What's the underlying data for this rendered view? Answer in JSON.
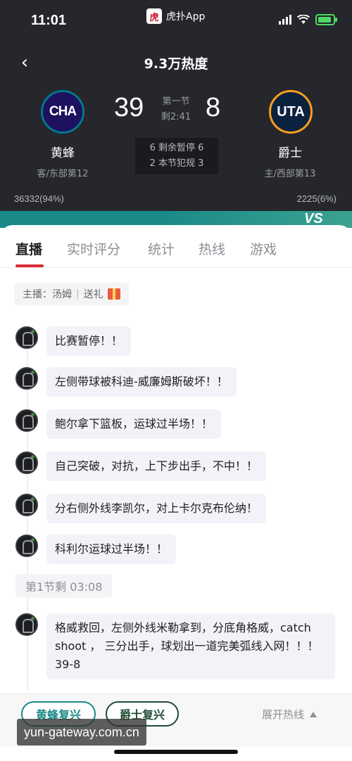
{
  "status_bar": {
    "time": "11:01",
    "app_logo": "虎",
    "app_name": "虎扑App"
  },
  "header": {
    "title": "9.3万热度",
    "home": {
      "abbr": "CHA",
      "name": "黄蜂",
      "rank": "客/东部第12",
      "score": "39",
      "support": "36332(94%)"
    },
    "away": {
      "abbr": "UTA",
      "name": "爵士",
      "rank": "主/西部第13",
      "score": "8",
      "support": "2225(6%)"
    },
    "period": "第一节",
    "clock": "剩2:41",
    "timeouts": "6 剩余暂停 6",
    "fouls": "2 本节犯规 3",
    "vs": "VS"
  },
  "tabs": [
    {
      "label": "直播"
    },
    {
      "label": "实时评分"
    },
    {
      "label": "统计"
    },
    {
      "label": "热线"
    },
    {
      "label": "游戏"
    }
  ],
  "host": {
    "label": "主播：汤姆",
    "gift": "送礼"
  },
  "messages": [
    "比赛暂停！！",
    "左侧带球被科迪-威廉姆斯破坏！！",
    "鲍尔拿下篮板，运球过半场！！",
    "自己突破，对抗，上下步出手，不中！！",
    "分右侧外线李凯尔，对上卡尔克布伦纳！",
    "科利尔运球过半场！！",
    "格威救回，左侧外线米勒拿到，分底角格威，catch shoot ， 三分出手，球划出一道完美弧线入网！！！ 39-8"
  ],
  "time_chip": "第1节剩 03:08",
  "bottom": {
    "home_revive": "黄蜂复兴",
    "away_revive": "爵士复兴",
    "expand": "展开热线"
  },
  "watermark": "yun-gateway.com.cn",
  "colors": {
    "accent": "#d92b36",
    "teal": "#1a8a88",
    "header_bg": "#25272c"
  }
}
